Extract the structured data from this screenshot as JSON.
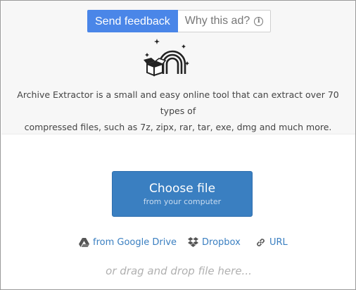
{
  "ad": {
    "send_feedback_label": "Send feedback",
    "why_this_ad_label": "Why this ad?"
  },
  "header": {
    "logo_icon": "archive-rainbow-box-icon",
    "description_line1": "Archive Extractor is a small and easy online tool that can extract over 70 types of",
    "description_line2": "compressed files, such as 7z, zipx, rar, tar, exe, dmg and much more."
  },
  "upload": {
    "choose_file_label": "Choose file",
    "choose_file_sub": "from your computer"
  },
  "sources": [
    {
      "icon": "google-drive-icon",
      "label": "from Google Drive"
    },
    {
      "icon": "dropbox-icon",
      "label": "Dropbox"
    },
    {
      "icon": "link-icon",
      "label": "URL"
    }
  ],
  "drag_drop_text": "or drag and drop file here...",
  "colors": {
    "feedback_button": "#4a86e8",
    "choose_button": "#3a7fc1",
    "link": "#3a7fc1",
    "top_background": "#f7f7f7"
  }
}
